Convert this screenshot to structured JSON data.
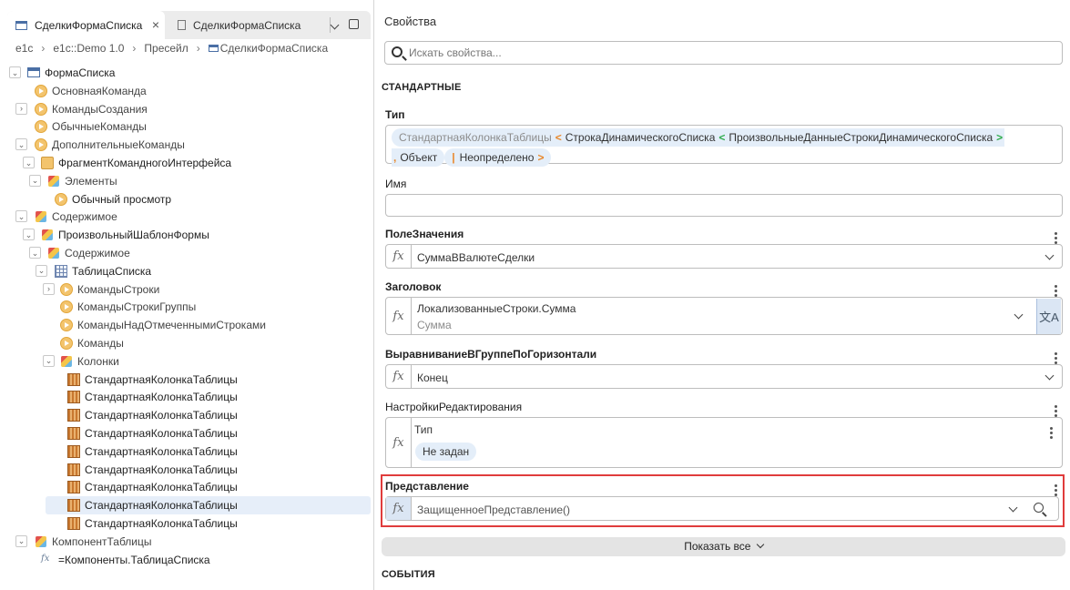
{
  "tabs": [
    {
      "label": "СделкиФормаСписка",
      "active": true
    },
    {
      "label": "СделкиФормаСписка",
      "active": false
    }
  ],
  "breadcrumb": [
    "e1c",
    "e1c::Demo 1.0",
    "Пресейл",
    "СделкиФормаСписка"
  ],
  "tree": [
    {
      "label": "ФормаСписка",
      "icon": "form-icon",
      "toggle": "v"
    },
    {
      "label": "ОсновнаяКоманда",
      "icon": "command-icon"
    },
    {
      "label": "КомандыСоздания",
      "icon": "command-icon",
      "toggle": ">"
    },
    {
      "label": "ОбычныеКоманды",
      "icon": "command-icon"
    },
    {
      "label": "ДополнительныеКоманды",
      "icon": "command-icon",
      "toggle": "v"
    },
    {
      "label": "ФрагментКомандногоИнтерфейса",
      "icon": "fragment-icon",
      "toggle": "v"
    },
    {
      "label": "Элементы",
      "icon": "cube-icon",
      "toggle": "v"
    },
    {
      "label": "Обычный просмотр",
      "icon": "command-icon"
    },
    {
      "label": "Содержимое",
      "icon": "cube-icon",
      "toggle": "v"
    },
    {
      "label": "ПроизвольныйШаблонФормы",
      "icon": "cube-icon",
      "toggle": "v"
    },
    {
      "label": "Содержимое",
      "icon": "cube-icon",
      "toggle": "v"
    },
    {
      "label": "ТаблицаСписка",
      "icon": "table-icon",
      "toggle": "v"
    },
    {
      "label": "КомандыСтроки",
      "icon": "command-icon",
      "toggle": ">"
    },
    {
      "label": "КомандыСтрокиГруппы",
      "icon": "command-icon"
    },
    {
      "label": "КомандыНадОтмеченнымиСтроками",
      "icon": "command-icon"
    },
    {
      "label": "Команды",
      "icon": "command-icon"
    },
    {
      "label": "Колонки",
      "icon": "cube-icon",
      "toggle": "v"
    },
    {
      "label": "СтандартнаяКолонкаТаблицы",
      "icon": "column-icon"
    },
    {
      "label": "СтандартнаяКолонкаТаблицы",
      "icon": "column-icon"
    },
    {
      "label": "СтандартнаяКолонкаТаблицы",
      "icon": "column-icon"
    },
    {
      "label": "СтандартнаяКолонкаТаблицы",
      "icon": "column-icon"
    },
    {
      "label": "СтандартнаяКолонкаТаблицы",
      "icon": "column-icon"
    },
    {
      "label": "СтандартнаяКолонкаТаблицы",
      "icon": "column-icon"
    },
    {
      "label": "СтандартнаяКолонкаТаблицы",
      "icon": "column-icon"
    },
    {
      "label": "СтандартнаяКолонкаТаблицы",
      "icon": "column-icon",
      "selected": true
    },
    {
      "label": "СтандартнаяКолонкаТаблицы",
      "icon": "column-icon"
    },
    {
      "label": "КомпонентТаблицы",
      "icon": "cube-icon",
      "toggle": "v"
    },
    {
      "label": "=Компоненты.ТаблицаСписка",
      "icon": "fx-icon"
    }
  ],
  "properties": {
    "title": "Свойства",
    "search_placeholder": "Искать свойства...",
    "section_standard": "СТАНДАРТНЫЕ",
    "section_events": "СОБЫТИЯ",
    "show_all": "Показать все",
    "type_label": "Тип",
    "type_chips": {
      "c1": "СтандартнаяКолонкаТаблицы",
      "c2": "СтрокаДинамическогоСписка",
      "c3": "ПроизвольныеДанныеСтрокиДинамическогоСписка",
      "c4": "Объект",
      "c5": "Неопределено"
    },
    "name_label": "Имя",
    "name_value": "",
    "value_field_label": "ПолеЗначения",
    "value_field_value": "СуммаВВалютеСделки",
    "header_label": "Заголовок",
    "header_value": "ЛокализованныеСтроки.Сумма",
    "header_hint": "Сумма",
    "align_label": "ВыравниваниеВГруппеПоГоризонтали",
    "align_value": "Конец",
    "edit_settings_label": "НастройкиРедактирования",
    "edit_type_label": "Тип",
    "edit_type_value": "Не задан",
    "presentation_label": "Представление",
    "presentation_value": "ЗащищенноеПредставление()"
  },
  "colors": {
    "highlight": "#e03c3c",
    "chip_bg": "#e4eef9",
    "selected_row": "#e6eef9"
  }
}
